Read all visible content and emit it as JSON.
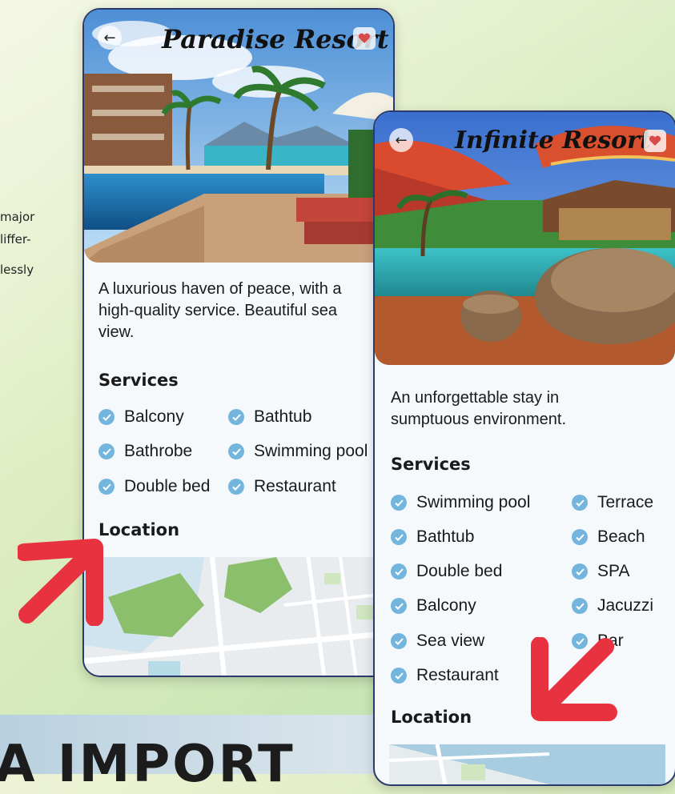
{
  "background_fragments": {
    "line1": "major",
    "line2": "liffer-",
    "line3": "lessly"
  },
  "bottom_heading": "A IMPORT",
  "screens": [
    {
      "title": "Paradise Resort",
      "back_icon": "arrow-left-icon",
      "favorite_icon": "heart-icon",
      "description": [
        "A luxurious haven of peace, with a",
        "high-quality service. Beautiful sea",
        "view."
      ],
      "services_heading": "Services",
      "services": [
        "Balcony",
        "Bathtub",
        "Bathrobe",
        "Swimming pool",
        "Double bed",
        "Restaurant"
      ],
      "location_heading": "Location"
    },
    {
      "title": "Infinite Resort",
      "back_icon": "arrow-left-icon",
      "favorite_icon": "heart-icon",
      "description": [
        "An unforgettable stay in",
        "sumptuous environment."
      ],
      "services_heading": "Services",
      "services": [
        "Swimming pool",
        "Terrace",
        "Bathtub",
        "Beach",
        "Double bed",
        "SPA",
        "Balcony",
        "Jacuzzi",
        "Sea view",
        "Bar",
        "Restaurant"
      ],
      "location_heading": "Location"
    }
  ],
  "colors": {
    "check": "#73b5dd",
    "arrow": "#e8323f",
    "phone_border": "#2a3a6a",
    "heart": "#d94b4b"
  }
}
